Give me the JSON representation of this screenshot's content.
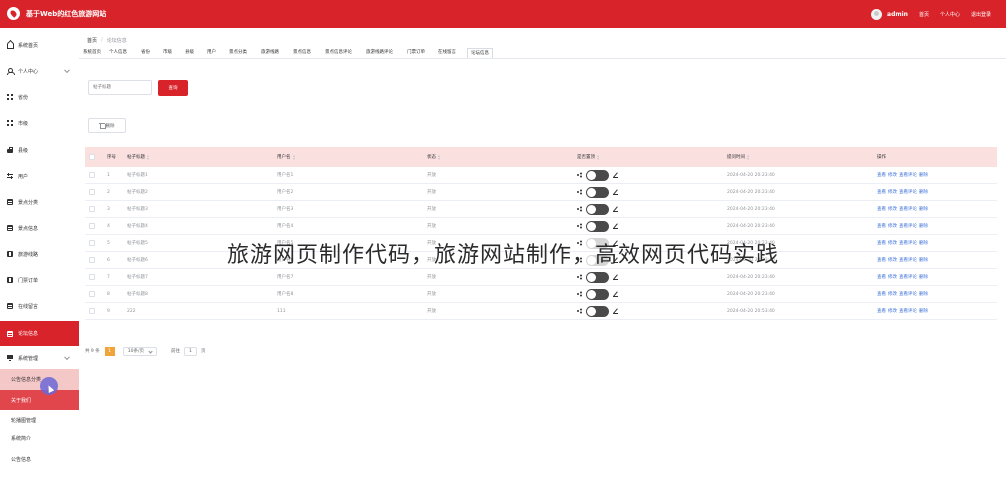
{
  "header": {
    "title": "基于Web的红色旅游网站",
    "user": "admin",
    "links": [
      "首页",
      "个人中心",
      "退出登录"
    ]
  },
  "sidebar": {
    "items": [
      {
        "label": "系统首页",
        "icon": "house-icon"
      },
      {
        "label": "个人中心",
        "icon": "person-icon"
      },
      {
        "label": "省份",
        "icon": "grid-icon"
      },
      {
        "label": "市级",
        "icon": "grid-icon"
      },
      {
        "label": "县级",
        "icon": "briefcase-icon"
      },
      {
        "label": "用户",
        "icon": "sliders-icon"
      },
      {
        "label": "景点分类",
        "icon": "doc-icon"
      },
      {
        "label": "景点信息",
        "icon": "doc-icon"
      },
      {
        "label": "旅游线路",
        "icon": "ticket-icon"
      },
      {
        "label": "门票订单",
        "icon": "ticket-icon"
      },
      {
        "label": "在线留言",
        "icon": "doc-icon"
      },
      {
        "label": "论坛信息",
        "icon": "doc-icon"
      },
      {
        "label": "系统管理",
        "icon": "monitor-icon"
      }
    ],
    "subitems": [
      "公告信息分类",
      "关于我们",
      "轮播图管理",
      "系统简介",
      "公告信息"
    ]
  },
  "breadcrumb": {
    "home": "首页",
    "separator": "/",
    "current": "论坛信息"
  },
  "tabs": [
    "系统首页",
    "个人信息",
    "省份",
    "市级",
    "县级",
    "用户",
    "景点分类",
    "旅游线路",
    "景点信息",
    "景点信息评论",
    "旅游线路评论",
    "门票订单",
    "在线留言",
    "论坛信息"
  ],
  "search": {
    "placeholder": "帖子标题",
    "button": "查询"
  },
  "toolbar": {
    "delete_label": "删除"
  },
  "table": {
    "headers": [
      "序号",
      "帖子标题",
      "用户名",
      "状态",
      "是否置顶",
      "提问时间",
      "操作"
    ],
    "rows": [
      {
        "index": "1",
        "title": "帖子标题1",
        "user": "用户名1",
        "status": "开放",
        "time": "2024-04-20 20:23:40",
        "on": false
      },
      {
        "index": "2",
        "title": "帖子标题2",
        "user": "用户名2",
        "status": "开放",
        "time": "2024-04-20 20:23:40",
        "on": false
      },
      {
        "index": "3",
        "title": "帖子标题3",
        "user": "用户名3",
        "status": "开放",
        "time": "2024-04-20 20:23:40",
        "on": false
      },
      {
        "index": "4",
        "title": "帖子标题4",
        "user": "用户名4",
        "status": "开放",
        "time": "2024-04-20 20:23:40",
        "on": false
      },
      {
        "index": "5",
        "title": "帖子标题5",
        "user": "用户名5",
        "status": "开放",
        "time": "2024-04-20 20:23:40",
        "on": true
      },
      {
        "index": "6",
        "title": "帖子标题6",
        "user": "用户名6",
        "status": "开放",
        "time": "2024-04-20 20:23:40",
        "on": true
      },
      {
        "index": "7",
        "title": "帖子标题7",
        "user": "用户名7",
        "status": "开放",
        "time": "2024-04-20 20:23:40",
        "on": false
      },
      {
        "index": "8",
        "title": "帖子标题8",
        "user": "用户名8",
        "status": "开放",
        "time": "2024-04-20 20:23:40",
        "on": false
      },
      {
        "index": "9",
        "title": "222",
        "user": "111",
        "status": "开放",
        "time": "2024-04-20 20:53:40",
        "on": false
      }
    ],
    "ops": [
      "查看",
      "修改",
      "查看评论",
      "删除"
    ]
  },
  "pagination": {
    "total": "共 9 条",
    "page": "1",
    "page_size": "10条/页",
    "goto": "前往",
    "goto_value": "1",
    "unit": "页"
  },
  "watermark": "旅游网页制作代码，旅游网站制作，高效网页代码实践",
  "colors": {
    "brand": "#d8232a",
    "header_row": "#fbe0e0",
    "link": "#3a6fd8",
    "page_active": "#f0a43a"
  }
}
